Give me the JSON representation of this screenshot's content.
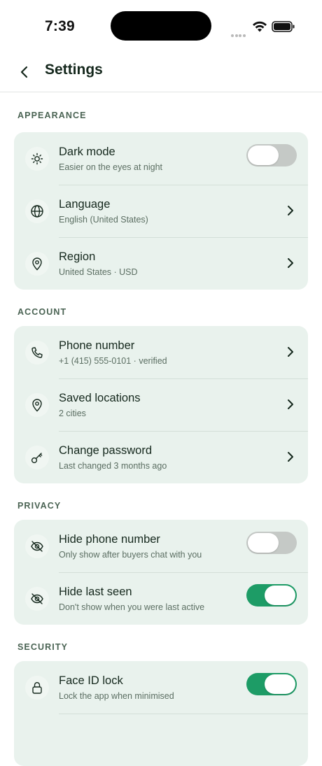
{
  "status_bar": {
    "time": "7:39"
  },
  "header": {
    "title": "Settings"
  },
  "sections": {
    "appearance": {
      "title": "APPEARANCE",
      "dark_mode": {
        "title": "Dark mode",
        "subtitle": "Easier on the eyes at night",
        "icon": "sun-icon",
        "toggle_on": false
      },
      "language": {
        "title": "Language",
        "subtitle": "English (United States)",
        "icon": "globe-icon"
      },
      "region": {
        "title": "Region",
        "subtitle": "United States · USD",
        "icon": "location-pin-icon"
      }
    },
    "account": {
      "title": "ACCOUNT",
      "phone": {
        "title": "Phone number",
        "subtitle": "+1 (415) 555-0101 · verified",
        "icon": "phone-icon"
      },
      "locations": {
        "title": "Saved locations",
        "subtitle": "2 cities",
        "icon": "location-pin-icon"
      },
      "password": {
        "title": "Change password",
        "subtitle": "Last changed 3 months ago",
        "icon": "key-icon"
      }
    },
    "privacy": {
      "title": "PRIVACY",
      "hide_phone": {
        "title": "Hide phone number",
        "subtitle": "Only show after buyers chat with you",
        "icon": "eye-off-icon",
        "toggle_on": false
      },
      "hide_last_seen": {
        "title": "Hide last seen",
        "subtitle": "Don't show when you were last active",
        "icon": "eye-off-icon",
        "toggle_on": true
      }
    },
    "security": {
      "title": "SECURITY",
      "face_id": {
        "title": "Face ID lock",
        "subtitle": "Lock the app when minimised",
        "icon": "lock-icon",
        "toggle_on": true
      }
    }
  },
  "colors": {
    "card_bg": "#e9f2ed",
    "accent_green": "#1d9c66",
    "toggle_off": "#c5c9c6",
    "section_title": "#4a6353"
  }
}
